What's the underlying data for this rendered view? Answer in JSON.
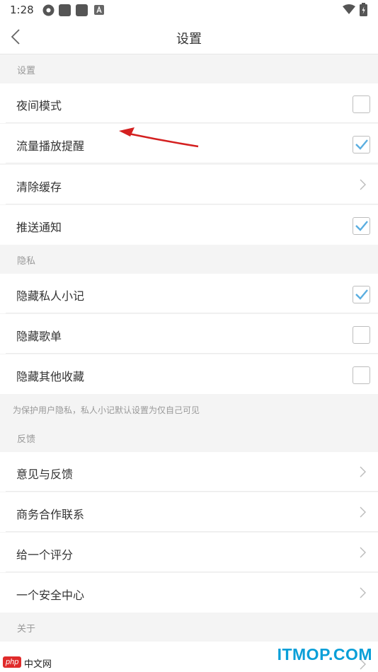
{
  "status_bar": {
    "time": "1:28"
  },
  "nav": {
    "title": "设置"
  },
  "sections": {
    "settings_header": "设置",
    "privacy_header": "隐私",
    "feedback_header": "反馈",
    "about_header": "关于"
  },
  "settings": {
    "night_mode": {
      "label": "夜间模式",
      "checked": false
    },
    "data_reminder": {
      "label": "流量播放提醒",
      "checked": true
    },
    "clear_cache": {
      "label": "清除缓存"
    },
    "push_notify": {
      "label": "推送通知",
      "checked": true
    }
  },
  "privacy": {
    "hide_notes": {
      "label": "隐藏私人小记",
      "checked": true
    },
    "hide_playlist": {
      "label": "隐藏歌单",
      "checked": false
    },
    "hide_other": {
      "label": "隐藏其他收藏",
      "checked": false
    },
    "note": "为保护用户隐私，私人小记默认设置为仅自己可见"
  },
  "feedback": {
    "suggestion": "意见与反馈",
    "business": "商务合作联系",
    "rate": "给一个评分",
    "security": "一个安全中心"
  },
  "watermark": {
    "brand": "ITMOP.COM",
    "logo": "php",
    "text": "中文网"
  },
  "colors": {
    "accent": "#5aaee0",
    "annotation_arrow": "#d42020"
  }
}
